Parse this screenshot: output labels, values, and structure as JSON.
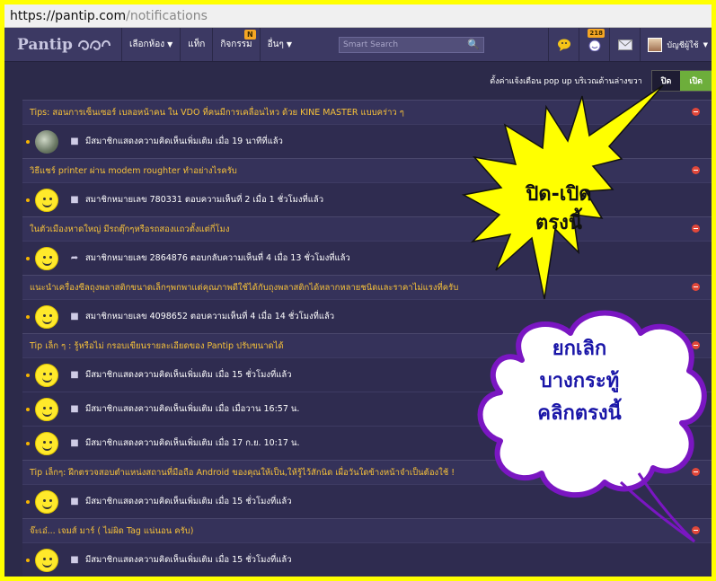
{
  "url": {
    "host": "https://pantip.com",
    "path": "/notifications"
  },
  "nav": {
    "logo_text": "Pantip",
    "items": [
      {
        "label": "เลือกห้อง",
        "caret": "▼"
      },
      {
        "label": "แท็ก"
      },
      {
        "label": "กิจกรรม",
        "badge": "N"
      },
      {
        "label": "อื่นๆ",
        "caret": "▼"
      }
    ],
    "search_placeholder": "Smart Search",
    "chat_badge": "218",
    "user_label": "บัญชีผู้ใช้"
  },
  "popup": {
    "label": "ตั้งค่าแจ้งเตือน pop up บริเวณด้านล่างขวา",
    "off_label": "ปิด",
    "on_label": "เปิด"
  },
  "groups": [
    {
      "title": "Tips: สอนการเซ็นเซอร์ เบลอหน้าคน ใน VDO ที่คนมีการเคลื่อนไหว ด้วย KINE MASTER แบบคร่าว ๆ",
      "rows": [
        {
          "avatar": "photo",
          "icon": "comment",
          "text": "มีสมาชิกแสดงความคิดเห็นเพิ่มเติม เมื่อ 19 นาทีที่แล้ว"
        }
      ]
    },
    {
      "title": "วิธีแชร์ printer ผ่าน modem roughter ทำอย่างไรครับ",
      "rows": [
        {
          "avatar": "smiley",
          "icon": "comment",
          "text": "สมาชิกหมายเลข 780331 ตอบความเห็นที่ 2 เมื่อ 1 ชั่วโมงที่แล้ว"
        }
      ]
    },
    {
      "title": "ในตัวเมืองหาดใหญ่ มีรถตุ๊กๆหรือรถสองแถวตั้งแต่กี่โมง",
      "rows": [
        {
          "avatar": "smiley",
          "icon": "reply",
          "text": "สมาชิกหมายเลข 2864876 ตอบกลับความเห็นที่ 4 เมื่อ 13 ชั่วโมงที่แล้ว"
        }
      ]
    },
    {
      "title": "แนะนำเครื่องซีลถุงพลาสติกขนาดเล็กๆพกพาแต่คุณภาพดีใช้ได้กับถุงพลาสติกได้หลากหลายชนิดและราคาไม่แรงที่ครับ",
      "rows": [
        {
          "avatar": "smiley",
          "icon": "comment",
          "text": "สมาชิกหมายเลข 4098652 ตอบความเห็นที่ 4 เมื่อ 14 ชั่วโมงที่แล้ว"
        }
      ]
    },
    {
      "title": "Tip เล็ก ๆ : รู้หรือไม่ กรอบเขียนรายละเอียดของ Pantip ปรับขนาดได้",
      "rows": [
        {
          "avatar": "smiley",
          "icon": "comment",
          "text": "มีสมาชิกแสดงความคิดเห็นเพิ่มเติม เมื่อ 15 ชั่วโมงที่แล้ว"
        },
        {
          "avatar": "smiley",
          "icon": "comment",
          "text": "มีสมาชิกแสดงความคิดเห็นเพิ่มเติม เมื่อ เมื่อวาน 16:57 น."
        },
        {
          "avatar": "smiley",
          "icon": "comment",
          "text": "มีสมาชิกแสดงความคิดเห็นเพิ่มเติม เมื่อ 17 ก.ย. 10:17 น."
        }
      ]
    },
    {
      "title": "Tip เล็กๆ: ฝึกตรวจสอบตำแหน่งสถานที่มือถือ Android ของคุณให้เป็น,ให้รู้ไว้สักนิด เผื่อวันใดข้างหน้าจำเป็นต้องใช้ !",
      "rows": [
        {
          "avatar": "smiley",
          "icon": "comment",
          "text": "มีสมาชิกแสดงความคิดเห็นเพิ่มเติม เมื่อ 15 ชั่วโมงที่แล้ว"
        }
      ]
    },
    {
      "title": "จ๊ะเอ๋... เจมส์ มาร์ ( ไม่ผิด Tag แน่นอน ครับ)",
      "rows": [
        {
          "avatar": "smiley",
          "icon": "comment",
          "text": "มีสมาชิกแสดงความคิดเห็นเพิ่มเติม เมื่อ 15 ชั่วโมงที่แล้ว"
        }
      ]
    }
  ],
  "annotations": {
    "burst_lines": [
      "ปิด-เปิด",
      "ตรงนี้"
    ],
    "cloud_lines": [
      "ยกเลิก",
      "บางกระทู้",
      "คลิกตรงนี้"
    ]
  },
  "colors": {
    "background": "#2c2a4a",
    "topic_title": "#f6c13a",
    "toggle_on": "#6dae3b",
    "border_highlight": "#ffff00",
    "burst_fill": "#ffff00",
    "cloud_stroke": "#7a16c2",
    "cloud_text": "#1a16a8",
    "remove_icon": "#e0473a"
  }
}
